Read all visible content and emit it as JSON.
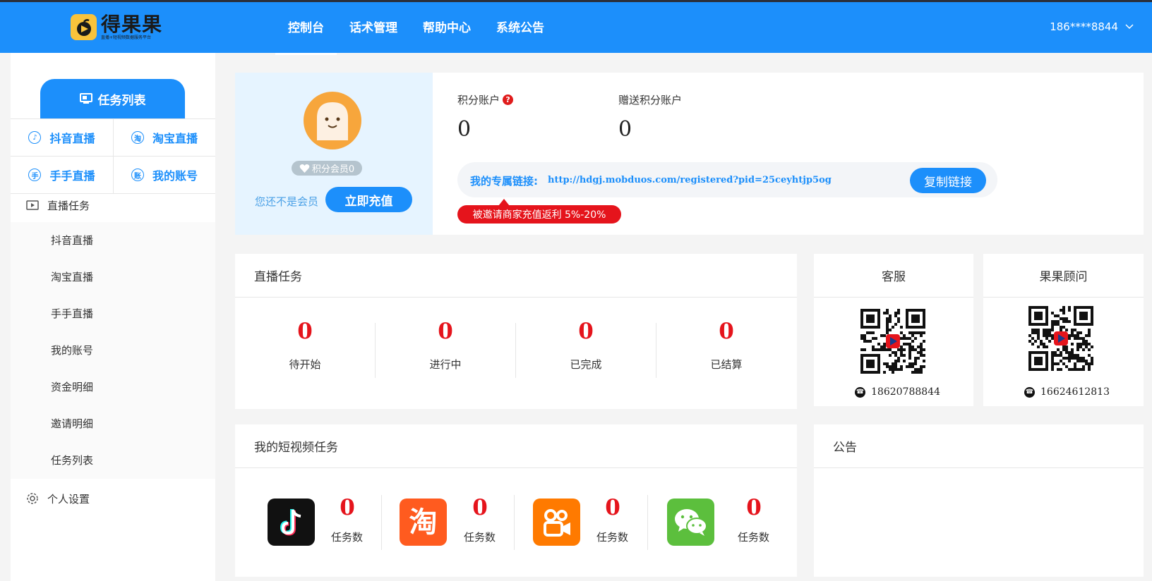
{
  "header": {
    "logo_name": "得果果",
    "logo_sub": "直播+短视频数据服务平台",
    "nav": [
      "控制台",
      "话术管理",
      "帮助中心",
      "系统公告"
    ],
    "active_nav": 0,
    "user": "186****8844"
  },
  "sidebar": {
    "head": "任务列表",
    "grid": [
      "抖音直播",
      "淘宝直播",
      "手手直播",
      "我的账号"
    ],
    "section1": "直播任务",
    "sub_items": [
      "抖音直播",
      "淘宝直播",
      "手手直播",
      "我的账号",
      "资金明细",
      "邀请明细",
      "任务列表"
    ],
    "section2": "个人设置"
  },
  "profile": {
    "member_badge": "积分会员0",
    "not_member": "您还不是会员",
    "recharge": "立即充值"
  },
  "accounts": {
    "points_label": "积分账户",
    "points_value": "0",
    "gift_label": "赠送积分账户",
    "gift_value": "0",
    "link_label": "我的专属链接:",
    "link_url": "http://hdgj.mobduos.com/registered?pid=25ceyhtjp5og",
    "copy_button": "复制链接",
    "rebate_tip": "被邀请商家充值返利 5%-20%"
  },
  "live_tasks": {
    "title": "直播任务",
    "stats": [
      {
        "value": "0",
        "label": "待开始"
      },
      {
        "value": "0",
        "label": "进行中"
      },
      {
        "value": "0",
        "label": "已完成"
      },
      {
        "value": "0",
        "label": "已结算"
      }
    ]
  },
  "service": {
    "title": "客服",
    "phone": "18620788844"
  },
  "advisor": {
    "title": "果果顾问",
    "phone": "16624612813"
  },
  "video_tasks": {
    "title": "我的短视频任务",
    "apps": [
      {
        "icon": "douyin-icon",
        "value": "0",
        "label": "任务数",
        "color": "#111111"
      },
      {
        "icon": "taobao-icon",
        "value": "0",
        "label": "任务数",
        "color": "#ff5b1f"
      },
      {
        "icon": "kuaishou-icon",
        "value": "0",
        "label": "任务数",
        "color": "#ff7a00"
      },
      {
        "icon": "wechat-icon",
        "value": "0",
        "label": "任务数",
        "color": "#5cbf3d"
      }
    ]
  },
  "notice": {
    "title": "公告"
  },
  "colors": {
    "primary": "#1c8ffb",
    "danger": "#e5141c",
    "logo": "#f9c33b"
  }
}
